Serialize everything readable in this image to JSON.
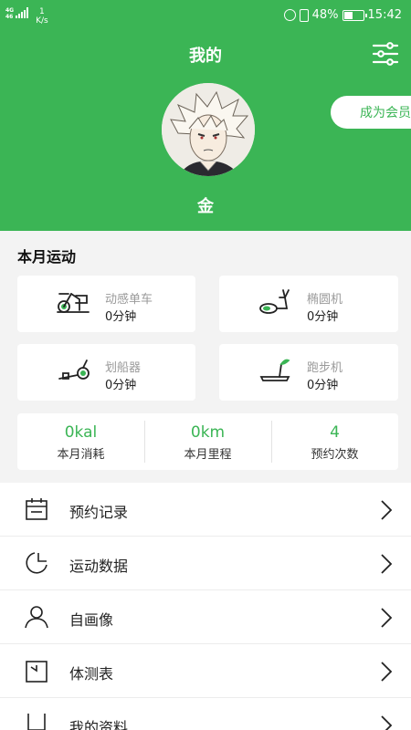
{
  "status_bar": {
    "network_top": "4G",
    "network_bottom": "46",
    "speed_value": "1",
    "speed_unit": "K/s",
    "battery_percent": "48%",
    "battery_level": 0.48,
    "time": "15:42"
  },
  "header": {
    "title": "我的",
    "member_button": "成为会员",
    "username": "金",
    "accent_color": "#3bb555"
  },
  "monthly": {
    "title": "本月运动",
    "equipment": [
      {
        "icon": "spin-bike-icon",
        "name": "动感单车",
        "value": "0分钟"
      },
      {
        "icon": "elliptical-icon",
        "name": "椭圆机",
        "value": "0分钟"
      },
      {
        "icon": "rowing-machine-icon",
        "name": "划船器",
        "value": "0分钟"
      },
      {
        "icon": "treadmill-icon",
        "name": "跑步机",
        "value": "0分钟"
      }
    ],
    "stats": [
      {
        "value": "0kal",
        "label": "本月消耗"
      },
      {
        "value": "0km",
        "label": "本月里程"
      },
      {
        "value": "4",
        "label": "预约次数"
      }
    ]
  },
  "menu": [
    {
      "icon": "calendar-icon",
      "label": "预约记录"
    },
    {
      "icon": "pie-chart-icon",
      "label": "运动数据"
    },
    {
      "icon": "person-icon",
      "label": "自画像"
    },
    {
      "icon": "scale-icon",
      "label": "体测表"
    },
    {
      "icon": "profile-icon",
      "label": "我的资料"
    }
  ]
}
